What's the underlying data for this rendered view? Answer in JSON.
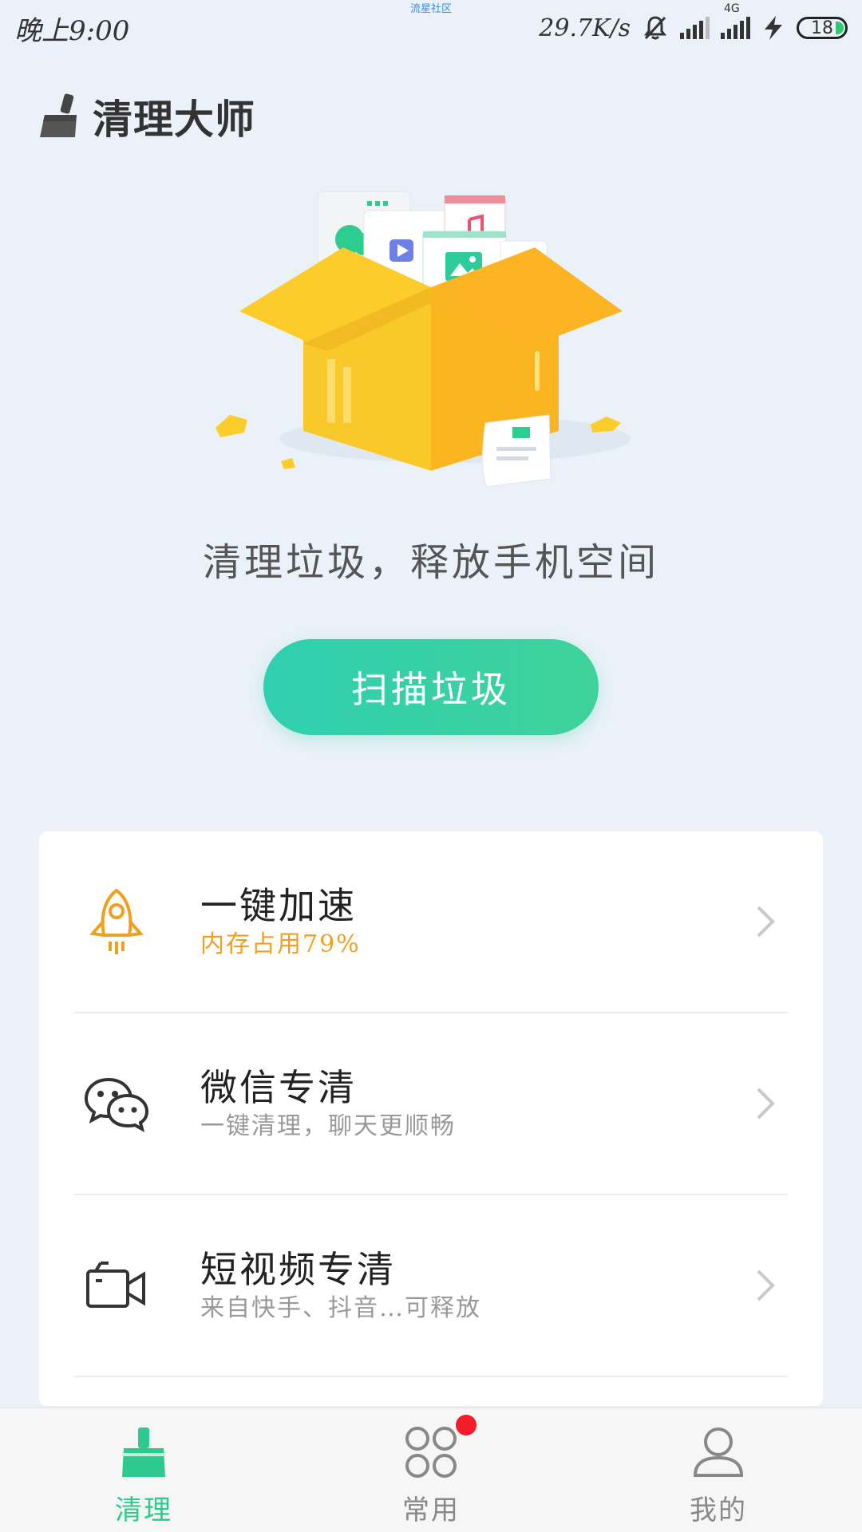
{
  "status_bar": {
    "time": "晚上9:00",
    "center_text": "流星社区",
    "net_speed": "29.7K/s",
    "network_type": "4G",
    "battery": "18"
  },
  "header": {
    "title": "清理大师"
  },
  "hero": {
    "slogan": "清理垃圾，释放手机空间",
    "scan_button": "扫描垃圾"
  },
  "features": [
    {
      "title": "一键加速",
      "subtitle": "内存占用79%",
      "icon": "rocket-icon",
      "subtitle_color": "#f0a020"
    },
    {
      "title": "微信专清",
      "subtitle": "一键清理，聊天更顺畅",
      "icon": "wechat-icon"
    },
    {
      "title": "短视频专清",
      "subtitle": "来自快手、抖音…可释放",
      "icon": "video-camera-icon"
    }
  ],
  "bottom_nav": {
    "items": [
      {
        "label": "清理",
        "icon": "broom-icon",
        "active": true
      },
      {
        "label": "常用",
        "icon": "grid-icon",
        "badge": true
      },
      {
        "label": "我的",
        "icon": "user-icon"
      }
    ]
  },
  "colors": {
    "accent": "#2ec98f",
    "background": "#eaf1f8",
    "warning": "#f0a020",
    "badge": "#f21c2a"
  }
}
